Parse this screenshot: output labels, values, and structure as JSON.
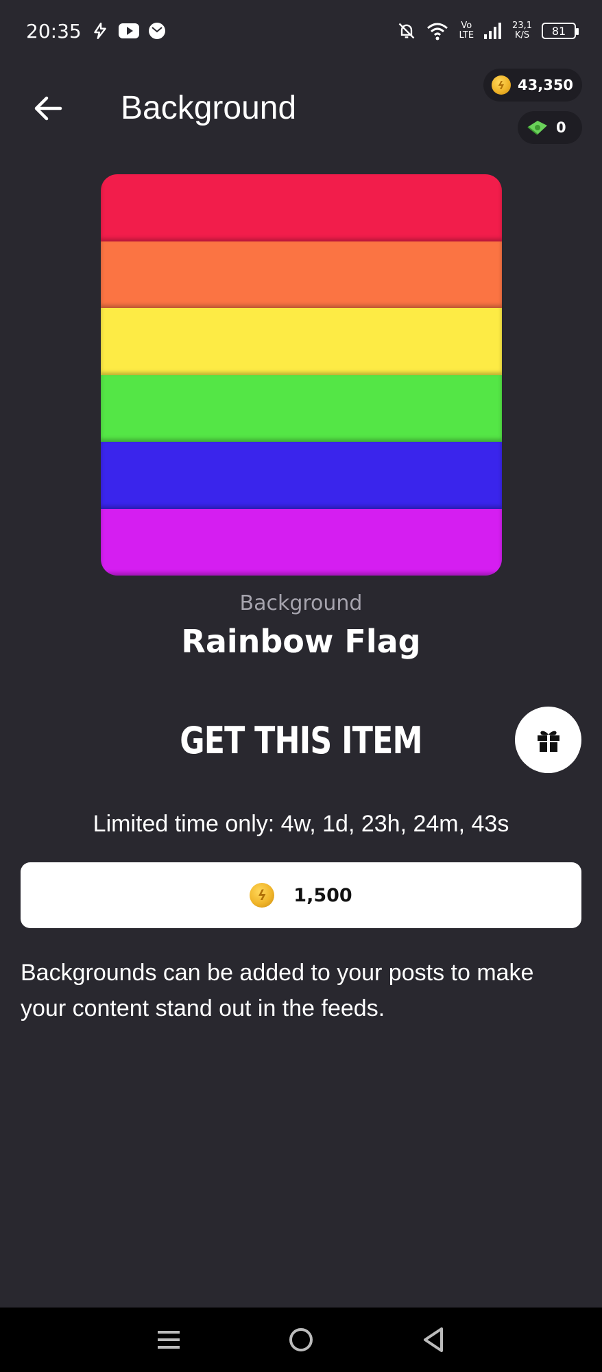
{
  "status_bar": {
    "time": "20:35",
    "network_speed_value": "23,1",
    "network_speed_unit": "K/S",
    "vo_top": "Vo",
    "vo_bottom": "LTE",
    "battery": "81"
  },
  "header": {
    "title": "Background"
  },
  "balances": {
    "coins": "43,350",
    "cash": "0"
  },
  "item": {
    "category": "Background",
    "name": "Rainbow Flag",
    "stripe_colors": [
      "#f21d4b",
      "#fb7443",
      "#fdeb45",
      "#54e646",
      "#3a25ec",
      "#d51ef1"
    ]
  },
  "purchase": {
    "title": "GET THIS ITEM",
    "limited_time": "Limited time only: 4w, 1d, 23h, 24m, 43s",
    "price": "1,500"
  },
  "description": "Backgrounds can be added to your posts to make your content stand out in the feeds.",
  "colors": {
    "background": "#29282f",
    "pill": "#1e1d23",
    "coin": "#f0b52a",
    "cash": "#6ad25a"
  }
}
